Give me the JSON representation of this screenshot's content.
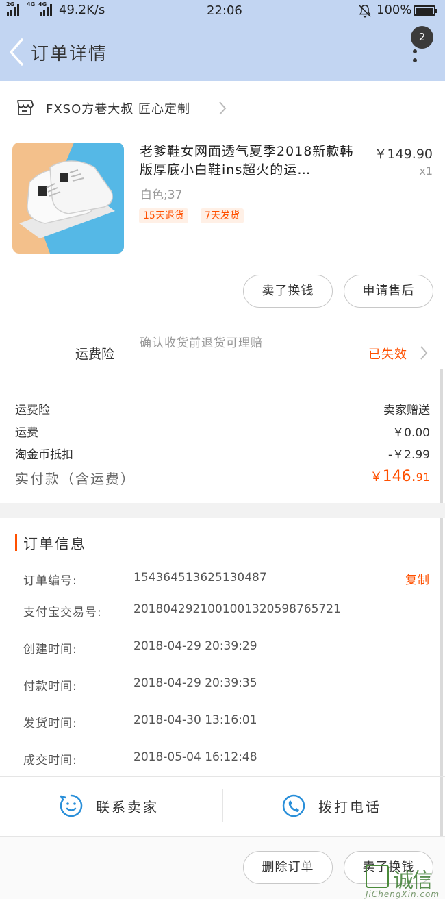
{
  "status_bar": {
    "net1": "2G",
    "net2": "4G",
    "net3": "4G",
    "speed": "49.2K/s",
    "time": "22:06",
    "battery": "100%"
  },
  "header": {
    "title": "订单详情",
    "badge_count": "2"
  },
  "shop": {
    "name": "FXSO方巷大叔 匠心定制"
  },
  "product": {
    "title": "老爹鞋女网面透气夏季2018新款韩版厚底小白鞋ins超火的运…",
    "price": "￥149.90",
    "qty": "x1",
    "sku": "白色;37",
    "tags": [
      "15天退货",
      "7天发货"
    ]
  },
  "product_actions": {
    "resell": "卖了换钱",
    "after_sale": "申请售后"
  },
  "insurance": {
    "label": "运费险",
    "desc": "确认收货前退货可理赔",
    "status": "已失效"
  },
  "fees": {
    "rows": [
      {
        "label": "运费险",
        "value": "卖家赠送"
      },
      {
        "label": "运费",
        "value": "￥0.00"
      },
      {
        "label": "淘金币抵扣",
        "value": "-￥2.99"
      }
    ],
    "paid_label": "实付款（含运费）",
    "paid_currency": "￥",
    "paid_int": "146.",
    "paid_dec": "91"
  },
  "order_info": {
    "title": "订单信息",
    "copy": "复制",
    "rows": [
      {
        "label": "订单编号:",
        "value": "154364513625130487"
      },
      {
        "label": "支付宝交易号:",
        "value": "2018042921001001320598765721"
      },
      {
        "label": "创建时间:",
        "value": "2018-04-29 20:39:29"
      },
      {
        "label": "付款时间:",
        "value": "2018-04-29 20:39:35"
      },
      {
        "label": "发货时间:",
        "value": "2018-04-30 13:16:01"
      },
      {
        "label": "成交时间:",
        "value": "2018-05-04 16:12:48"
      }
    ]
  },
  "contact": {
    "seller": "联系卖家",
    "phone": "拨打电话"
  },
  "bottom_actions": {
    "delete": "删除订单",
    "resell": "卖了换钱"
  },
  "watermark": {
    "cn": "诚信",
    "url": "JiChengXin.com"
  },
  "colors": {
    "header_bg": "#c2d5f2",
    "accent": "#ff5000",
    "icon_blue": "#2a8fd9"
  }
}
